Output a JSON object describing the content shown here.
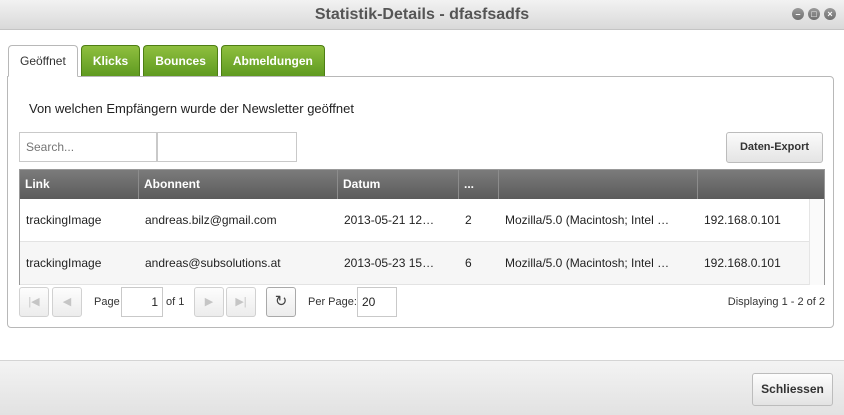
{
  "window": {
    "title": "Statistik-Details - dfasfsadfs",
    "buttons": [
      "minimize-icon",
      "maximize-icon",
      "close-icon"
    ]
  },
  "tabs": [
    {
      "label": "Geöffnet",
      "active": true
    },
    {
      "label": "Klicks",
      "active": false
    },
    {
      "label": "Bounces",
      "active": false
    },
    {
      "label": "Abmeldungen",
      "active": false
    }
  ],
  "panel": {
    "heading": "Von welchen Empfängern wurde der Newsletter geöffnet",
    "search_placeholder": "Search...",
    "export_label": "Daten-Export"
  },
  "table": {
    "columns": [
      "Link",
      "Abonnent",
      "Datum",
      "...",
      "",
      ""
    ],
    "rows": [
      [
        "trackingImage",
        "andreas.bilz@gmail.com",
        "2013-05-21 12…",
        "2",
        "Mozilla/5.0 (Macintosh; Intel …",
        "192.168.0.101"
      ],
      [
        "trackingImage",
        "andreas@subsolutions.at",
        "2013-05-23 15…",
        "6",
        "Mozilla/5.0 (Macintosh; Intel …",
        "192.168.0.101"
      ]
    ]
  },
  "pager": {
    "page_label": "Page",
    "page_value": "1",
    "of_label": "of 1",
    "per_page_label": "Per Page:",
    "per_page_value": "20",
    "displaying": "Displaying 1 - 2 of 2",
    "icons": {
      "first": "first-page-icon",
      "prev": "prev-page-icon",
      "next": "next-page-icon",
      "last": "last-page-icon",
      "refresh": "refresh-icon"
    }
  },
  "footer": {
    "close_label": "Schliessen"
  },
  "colors": {
    "tab_green": "#6fa52a",
    "header_gray": "#6a6a6a"
  }
}
